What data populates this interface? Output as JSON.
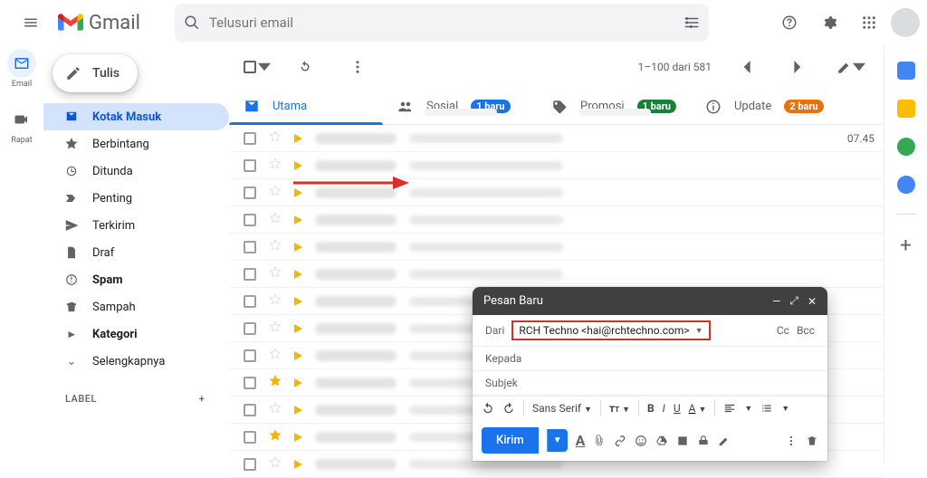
{
  "header": {
    "product": "Gmail",
    "search_placeholder": "Telusuri email"
  },
  "leftrail": {
    "mail": "Email",
    "meet": "Rapat"
  },
  "compose_label": "Tulis",
  "nav": [
    {
      "label": "Kotak Masuk",
      "active": true,
      "bold": true,
      "icon": "inbox"
    },
    {
      "label": "Berbintang",
      "icon": "star"
    },
    {
      "label": "Ditunda",
      "icon": "clock"
    },
    {
      "label": "Penting",
      "icon": "important"
    },
    {
      "label": "Terkirim",
      "icon": "send"
    },
    {
      "label": "Draf",
      "icon": "file"
    },
    {
      "label": "Spam",
      "bold": true,
      "icon": "spam"
    },
    {
      "label": "Sampah",
      "icon": "trash"
    },
    {
      "label": "Kategori",
      "bold": true,
      "icon": "categories"
    },
    {
      "label": "Selengkapnya",
      "icon": "more"
    }
  ],
  "label_section": "LABEL",
  "toolbar": {
    "pagination": "1–100 dari 581"
  },
  "tabs": {
    "primary": "Utama",
    "social": "Sosial",
    "social_badge": "1 baru",
    "promo": "Promosi",
    "promo_badge": "1 baru",
    "updates": "Update",
    "updates_badge": "2 baru"
  },
  "first_row_time": "07.45",
  "compose_window": {
    "title": "Pesan Baru",
    "from_label": "Dari",
    "from_value": "RCH Techno <hai@rchtechno.com>",
    "cc": "Cc",
    "bcc": "Bcc",
    "to": "Kepada",
    "subject": "Subjek",
    "font": "Sans Serif",
    "send": "Kirim"
  }
}
